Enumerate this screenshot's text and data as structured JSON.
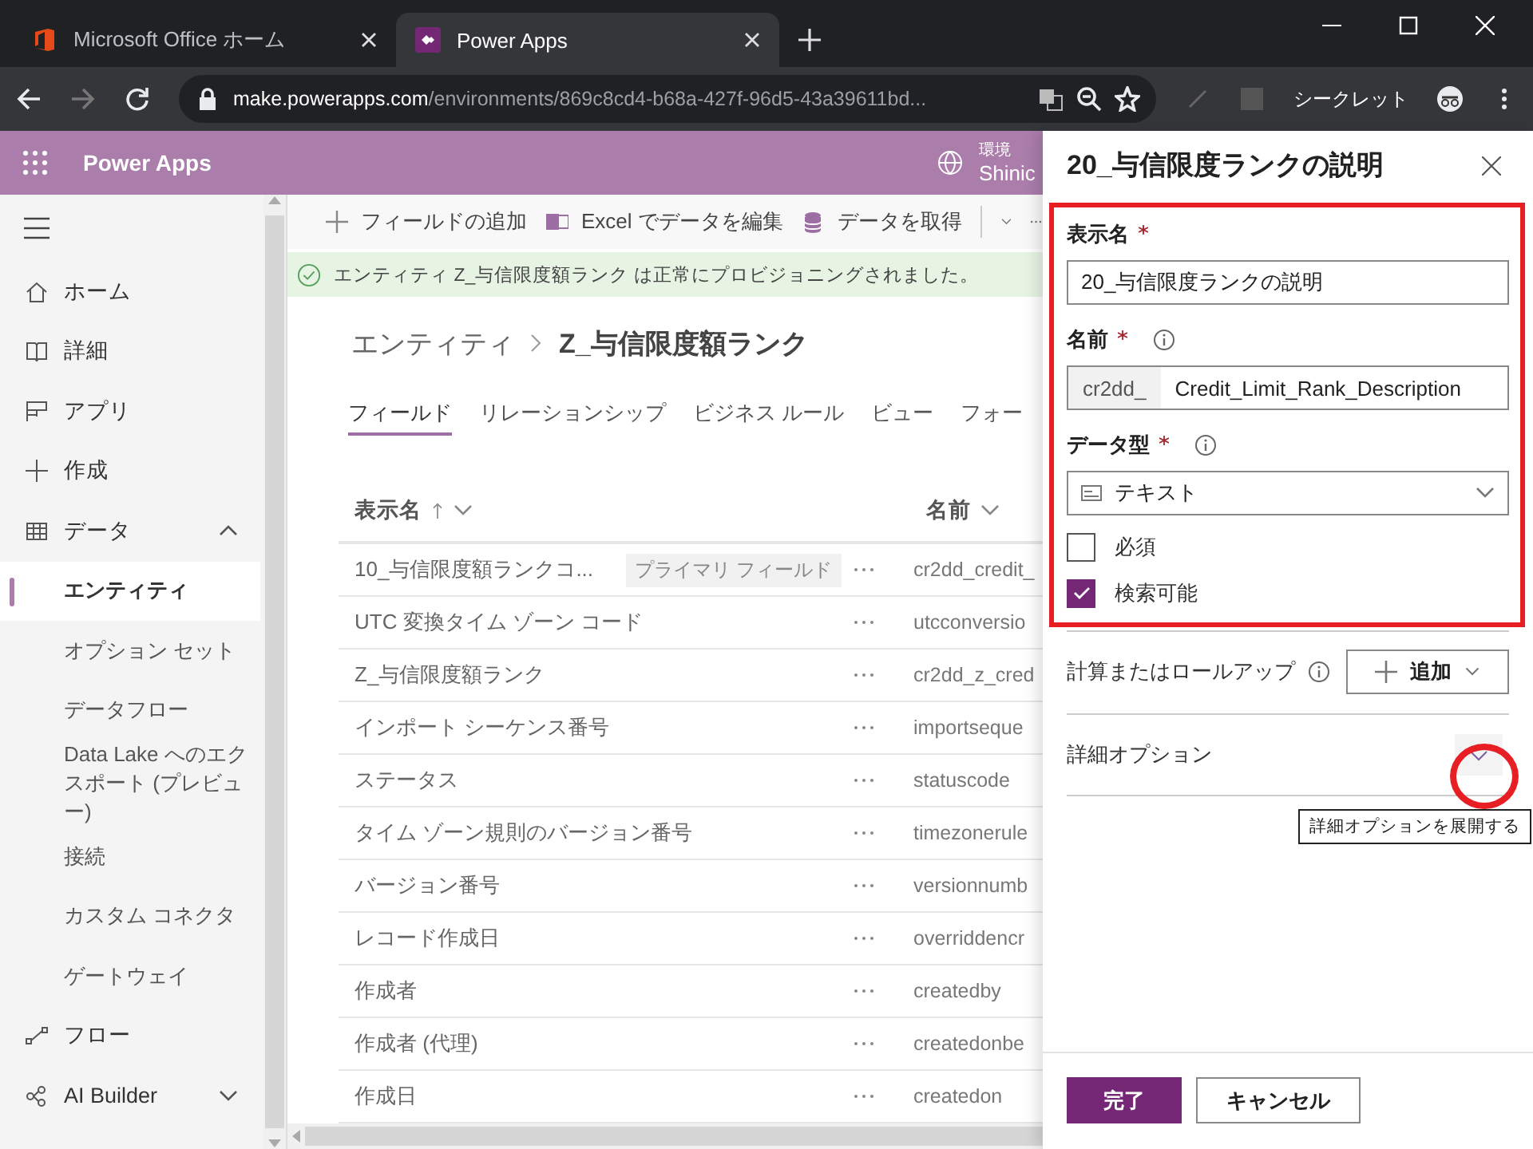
{
  "browser": {
    "tabs": [
      {
        "title": "Microsoft Office ホーム",
        "kind": "office",
        "selected": false
      },
      {
        "title": "Power Apps",
        "kind": "powerapps",
        "selected": true
      }
    ],
    "address": {
      "host": "make.powerapps.com",
      "path": "/environments/869c8cd4-b68a-427f-96d5-43a39611bd..."
    },
    "profile_label": "シークレット"
  },
  "app_bar": {
    "title": "Power Apps",
    "environment_label": "環境",
    "environment_name": "Shinic"
  },
  "nav": {
    "items": [
      {
        "label": "ホーム",
        "kind": "home",
        "selected": false
      },
      {
        "label": "詳細",
        "kind": "book",
        "selected": false
      },
      {
        "label": "アプリ",
        "kind": "apps",
        "selected": false
      },
      {
        "label": "作成",
        "kind": "plus",
        "selected": false
      },
      {
        "label": "データ",
        "kind": "table",
        "selected": false,
        "expanded": true,
        "children": [
          {
            "label": "エンティティ",
            "selected": true
          },
          {
            "label": "オプション セット",
            "selected": false
          },
          {
            "label": "データフロー",
            "selected": false
          },
          {
            "label": "Data Lake へのエクスポート (プレビュー)",
            "selected": false
          },
          {
            "label": "接続",
            "selected": false
          },
          {
            "label": "カスタム コネクタ",
            "selected": false
          },
          {
            "label": "ゲートウェイ",
            "selected": false
          }
        ]
      },
      {
        "label": "フロー",
        "kind": "flow",
        "selected": false
      },
      {
        "label": "AI Builder",
        "kind": "ai",
        "selected": false,
        "expanded": false
      }
    ]
  },
  "command_bar": [
    {
      "label": "フィールドの追加",
      "kind": "plus"
    },
    {
      "label": "Excel でデータを編集",
      "kind": "excel"
    },
    {
      "label": "データを取得",
      "kind": "database"
    }
  ],
  "notification": {
    "text": "エンティティ Z_与信限度額ランク は正常にプロビジョニングされました。"
  },
  "breadcrumb": {
    "parent": "エンティティ",
    "current": "Z_与信限度額ランク"
  },
  "tabs": [
    {
      "label": "フィールド",
      "selected": true
    },
    {
      "label": "リレーションシップ",
      "selected": false
    },
    {
      "label": "ビジネス ルール",
      "selected": false
    },
    {
      "label": "ビュー",
      "selected": false
    },
    {
      "label": "フォー",
      "selected": false
    }
  ],
  "table": {
    "columns": [
      {
        "label": "表示名",
        "sorted_ascending": true
      },
      {
        "label": "名前",
        "sorted_ascending": false
      }
    ],
    "rows": [
      {
        "display_name": "10_与信限度額ランクコ...",
        "badge": "プライマリ フィールド",
        "name": "cr2dd_credit_"
      },
      {
        "display_name": "UTC 変換タイム ゾーン コード",
        "name": "utcconversio"
      },
      {
        "display_name": "Z_与信限度額ランク",
        "name": "cr2dd_z_cred"
      },
      {
        "display_name": "インポート シーケンス番号",
        "name": "importseque"
      },
      {
        "display_name": "ステータス",
        "name": "statuscode"
      },
      {
        "display_name": "タイム ゾーン規則のバージョン番号",
        "name": "timezonerule"
      },
      {
        "display_name": "バージョン番号",
        "name": "versionnumb"
      },
      {
        "display_name": "レコード作成日",
        "name": "overriddencr"
      },
      {
        "display_name": "作成者",
        "name": "createdby"
      },
      {
        "display_name": "作成者 (代理)",
        "name": "createdonbe"
      },
      {
        "display_name": "作成日",
        "name": "createdon"
      }
    ]
  },
  "panel": {
    "title": "20_与信限度ランクの説明",
    "display_name": {
      "label": "表示名",
      "required": true,
      "value": "20_与信限度ランクの説明"
    },
    "name": {
      "label": "名前",
      "required": true,
      "prefix": "cr2dd_",
      "value": "Credit_Limit_Rank_Description"
    },
    "data_type": {
      "label": "データ型",
      "required": true,
      "value": "テキスト"
    },
    "checkboxes": [
      {
        "label": "必須",
        "checked": false
      },
      {
        "label": "検索可能",
        "checked": true
      }
    ],
    "calculation": {
      "label": "計算またはロールアップ",
      "button": "追加"
    },
    "advanced": {
      "label": "詳細オプション",
      "expanded": false,
      "tooltip": "詳細オプションを展開する"
    },
    "buttons": [
      {
        "label": "完了",
        "kind": "primary"
      },
      {
        "label": "キャンセル",
        "kind": "secondary"
      }
    ],
    "highlight_frame": true,
    "highlight_circle": true
  }
}
